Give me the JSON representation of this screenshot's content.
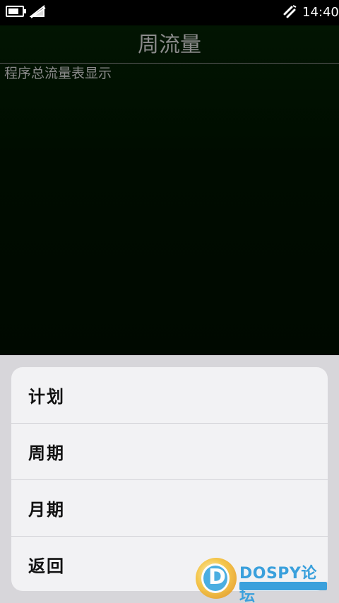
{
  "status_bar": {
    "time": "14:40",
    "icons": [
      "battery-icon",
      "signal-off-icon",
      "network-icon"
    ]
  },
  "screen": {
    "title": "周流量",
    "subtitle": "程序总流量表显示"
  },
  "menu": {
    "items": [
      {
        "label": "计划"
      },
      {
        "label": "周期"
      },
      {
        "label": "月期"
      },
      {
        "label": "返回"
      }
    ]
  },
  "watermark": {
    "logo_letter": "D",
    "brand": "DOSPY论坛"
  },
  "colors": {
    "app_background": "#000c00",
    "sheet_backdrop": "#d7d6da",
    "menu_card": "#f2f2f4",
    "title_text": "#8a8a8a",
    "watermark_accent": "#3aa0dc"
  }
}
